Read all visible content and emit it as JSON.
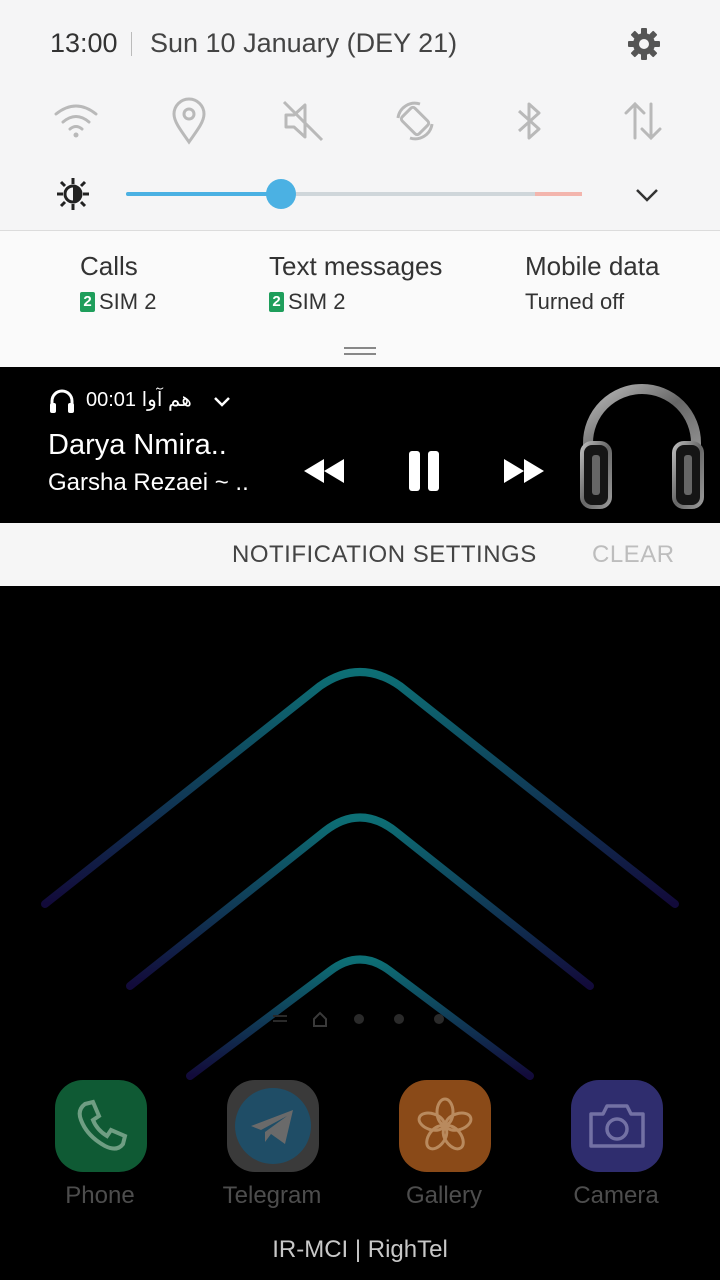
{
  "status": {
    "time": "13:00",
    "date": "Sun 10 January (DEY 21)"
  },
  "quick_settings": {
    "tiles": [
      {
        "icon": "wifi-icon",
        "state": "off"
      },
      {
        "icon": "location-icon",
        "state": "off"
      },
      {
        "icon": "mute-icon",
        "state": "off"
      },
      {
        "icon": "auto-rotate-icon",
        "state": "off"
      },
      {
        "icon": "bluetooth-icon",
        "state": "off"
      },
      {
        "icon": "mobile-data-icon",
        "state": "off"
      }
    ],
    "brightness_level": 0.34,
    "colors": {
      "accent": "#4bb1e3",
      "track": "#cfd6da",
      "overlimit": "#f3b5ad"
    }
  },
  "sim_info": {
    "calls": {
      "title": "Calls",
      "sim_number": "2",
      "sim_label": "SIM 2"
    },
    "text_messages": {
      "title": "Text messages",
      "sim_number": "2",
      "sim_label": "SIM 2"
    },
    "mobile_data": {
      "title": "Mobile data",
      "status": "Turned off"
    }
  },
  "media": {
    "app_label": "هم آوا 00:01",
    "title": "Darya Nmira..",
    "artist": "Garsha Rezaei ~ ..",
    "controls": [
      "rewind-icon",
      "pause-icon",
      "fast-forward-icon"
    ]
  },
  "notification_actions": {
    "settings": "NOTIFICATION SETTINGS",
    "clear": "CLEAR"
  },
  "home": {
    "apps": [
      {
        "label": "Phone",
        "color": "#0f5a34"
      },
      {
        "label": "Telegram",
        "color": "#3a3a3a"
      },
      {
        "label": "Gallery",
        "color": "#8a4a18"
      },
      {
        "label": "Camera",
        "color": "#2f2d6e"
      }
    ],
    "carrier": "IR-MCI | RighTel"
  }
}
